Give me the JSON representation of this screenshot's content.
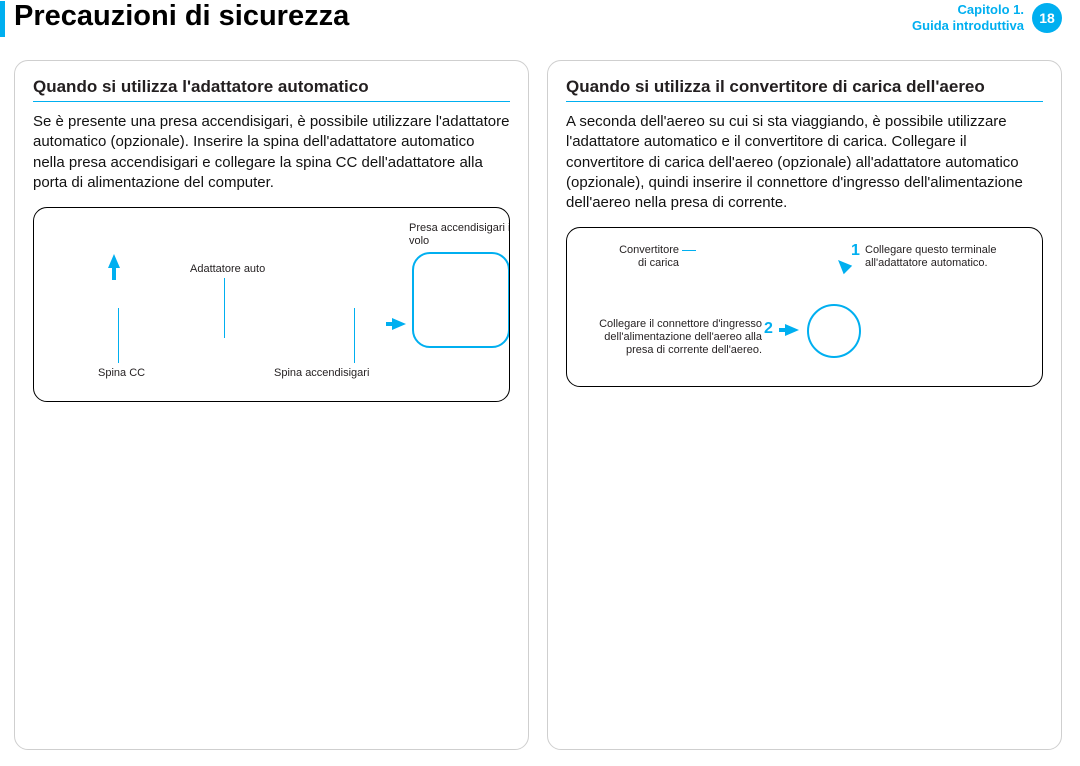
{
  "page": {
    "title": "Precauzioni di sicurezza",
    "chapter_line1": "Capitolo 1.",
    "chapter_line2": "Guida introduttiva",
    "page_number": "18"
  },
  "left": {
    "heading": "Quando si utilizza l'adattatore automatico",
    "body": "Se è presente una presa accendisigari, è possibile utilizzare l'adattatore automatico (opzionale). Inserire la spina dell'adattatore automatico nella presa accendisigari e collegare la spina CC dell'adattatore alla porta di alimentazione del computer.",
    "labels": {
      "spina_cc": "Spina CC",
      "adattatore_auto": "Adattatore auto",
      "spina_accendisigari": "Spina accendisigari",
      "presa_in_volo": "Presa accendisigari in volo"
    }
  },
  "right": {
    "heading": "Quando si utilizza il convertitore di carica dell'aereo",
    "body": "A seconda dell'aereo su cui si sta viaggiando, è possibile utilizzare l'adattatore automatico e il convertitore di carica. Collegare il convertitore di carica dell'aereo (opzionale) all'adattatore automatico (opzionale), quindi inserire il connettore d'ingresso dell'alimentazione dell'aereo nella presa di corrente.",
    "labels": {
      "convertitore": "Convertitore di carica",
      "step1": "Collegare questo terminale all'adattatore automatico.",
      "step2": "Collegare il connettore d'ingresso dell'alimentazione dell'aereo alla presa di corrente dell'aereo.",
      "n1": "1",
      "n2": "2"
    }
  }
}
